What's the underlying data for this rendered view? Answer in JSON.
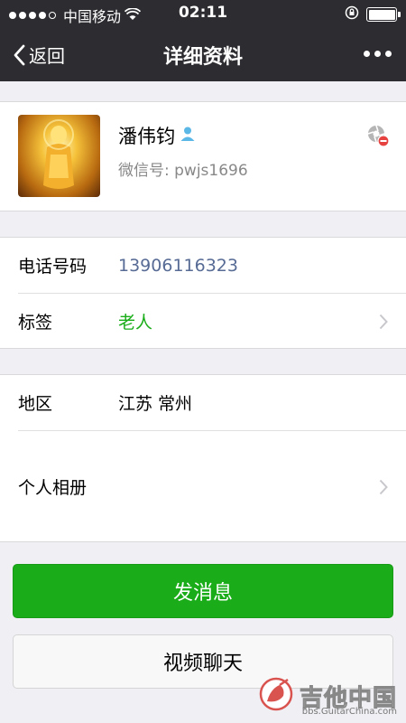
{
  "status_bar": {
    "carrier": "中国移动",
    "time": "02:11"
  },
  "nav": {
    "back_label": "返回",
    "title": "详细资料"
  },
  "profile": {
    "name": "潘伟钧",
    "wechat_id_label": "微信号:",
    "wechat_id": "pwjs1696"
  },
  "info": {
    "phone_label": "电话号码",
    "phone_value": "13906116323",
    "tag_label": "标签",
    "tag_value": "老人",
    "region_label": "地区",
    "region_value": "江苏 常州",
    "album_label": "个人相册"
  },
  "actions": {
    "send_message": "发消息",
    "video_chat": "视频聊天"
  },
  "watermark": {
    "text": "吉他中国",
    "url": "bbs.GuitarChina.com"
  },
  "colors": {
    "header_bg": "#2d2d31",
    "primary_green": "#1aad19",
    "link_blue": "#576b95",
    "tag_green": "#1aad19"
  }
}
